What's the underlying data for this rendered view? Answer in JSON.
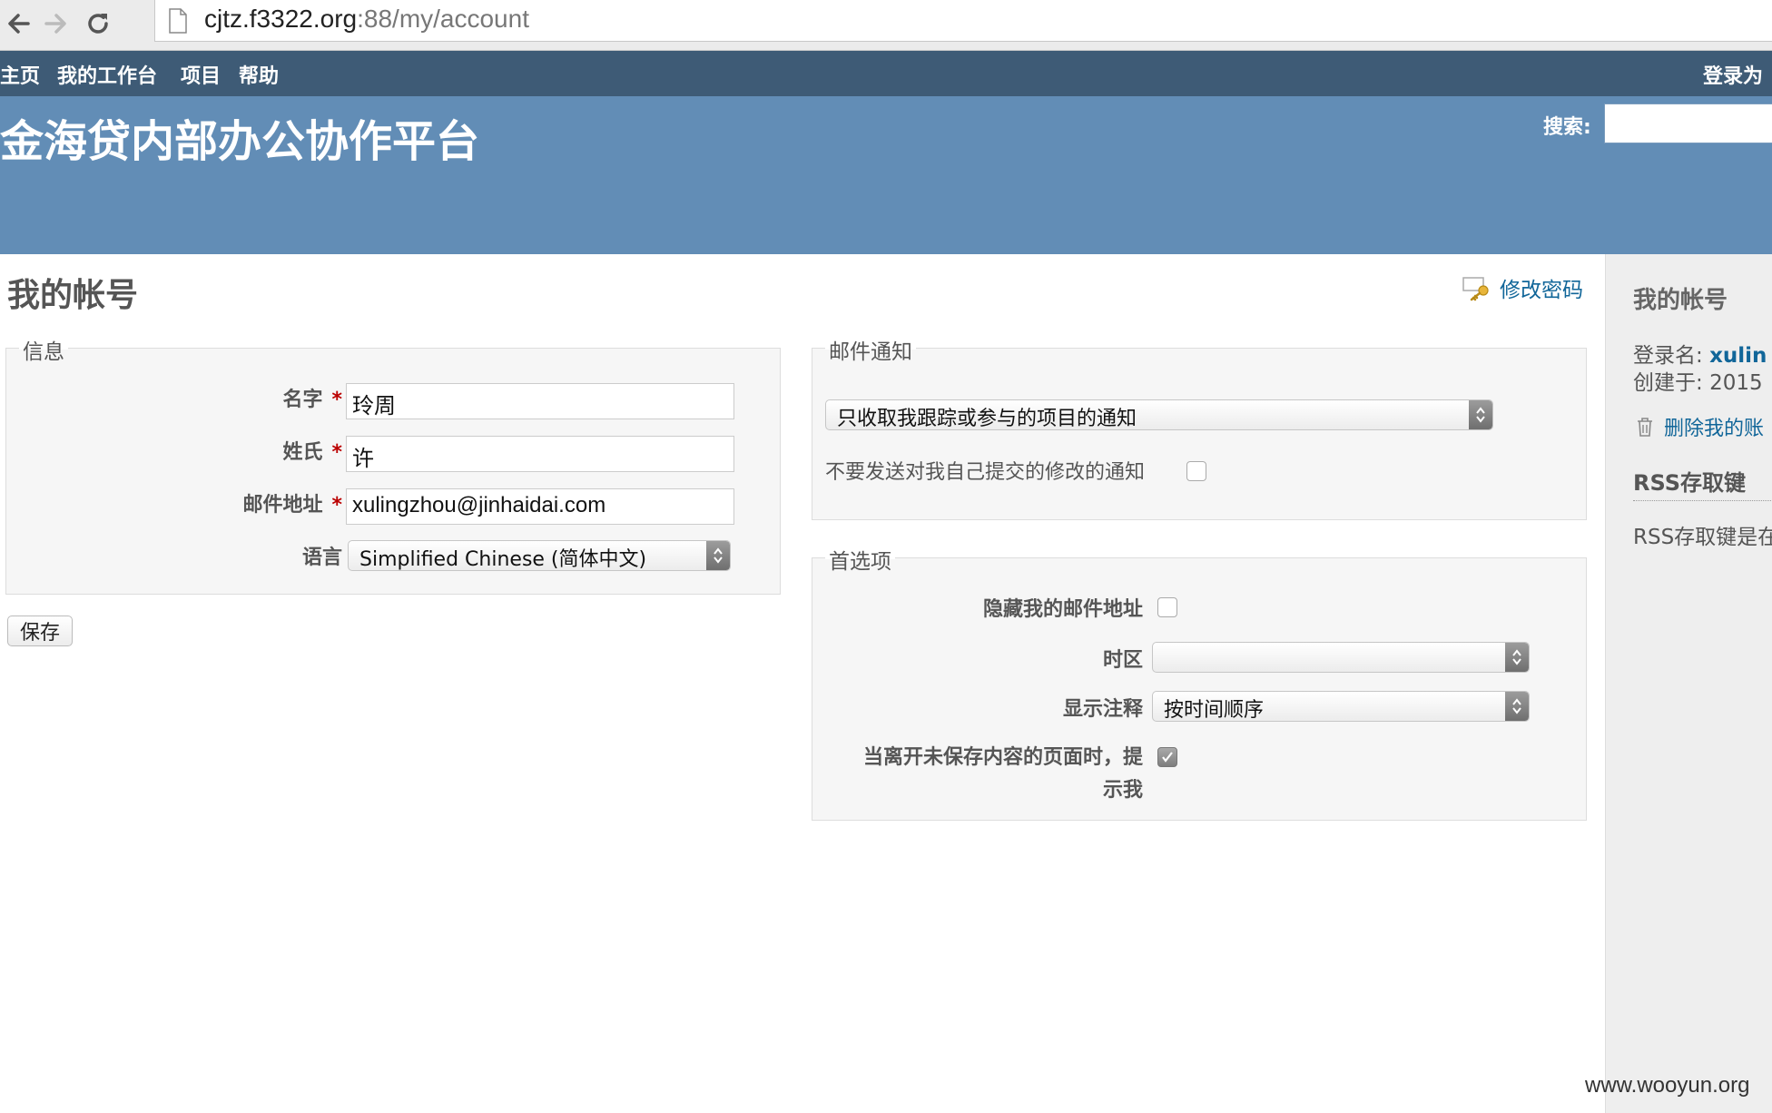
{
  "browser": {
    "url_host": "cjtz.f3322.org",
    "url_rest": ":88/my/account"
  },
  "topmenu": {
    "items": [
      "主页",
      "我的工作台",
      "项目",
      "帮助"
    ],
    "logged_as": "登录为"
  },
  "header": {
    "site_title": "金海贷内部办公协作平台",
    "search_label": "搜索:"
  },
  "page": {
    "title": "我的帐号",
    "change_password": "修改密码"
  },
  "info": {
    "legend": "信息",
    "firstname_label": "名字",
    "firstname_value": "玲周",
    "lastname_label": "姓氏",
    "lastname_value": "许",
    "email_label": "邮件地址",
    "email_value": "xulingzhou@jinhaidai.com",
    "language_label": "语言",
    "language_value": "Simplified Chinese (简体中文)",
    "required_mark": "*"
  },
  "save_label": "保存",
  "mail_notification": {
    "legend": "邮件通知",
    "option": "只收取我跟踪或参与的项目的通知",
    "no_self_notified_label": "不要发送对我自己提交的修改的通知",
    "no_self_notified_checked": false
  },
  "preferences": {
    "legend": "首选项",
    "hide_mail_label": "隐藏我的邮件地址",
    "hide_mail_checked": false,
    "timezone_label": "时区",
    "timezone_value": "",
    "comments_label": "显示注释",
    "comments_value": "按时间顺序",
    "warn_unsaved_label_1": "当离开未保存内容的页面时，提",
    "warn_unsaved_label_2": "示我",
    "warn_unsaved_checked": true
  },
  "sidebar": {
    "title": "我的帐号",
    "login_label": "登录名:",
    "login_value": "xulin",
    "created_label": "创建于:",
    "created_value": "2015",
    "delete_account": "删除我的账",
    "rss_title": "RSS存取键",
    "rss_text": "RSS存取键是在"
  },
  "watermark": "www.wooyun.org"
}
